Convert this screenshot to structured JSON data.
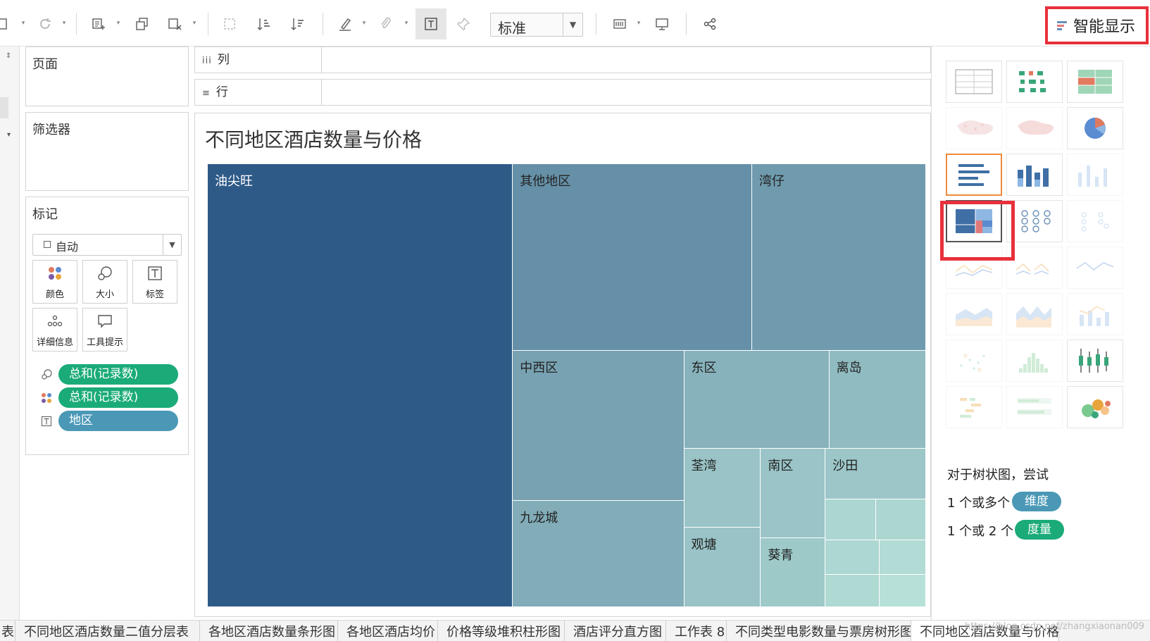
{
  "toolbar": {
    "fit_select": {
      "value": "标准"
    },
    "show_me_button": {
      "label": "智能显示"
    }
  },
  "panels": {
    "pages": {
      "title": "页面"
    },
    "filters": {
      "title": "筛选器"
    },
    "marks": {
      "title": "标记",
      "mark_type": "自动",
      "cards": [
        {
          "label": "颜色",
          "icon": "color-dots-icon"
        },
        {
          "label": "大小",
          "icon": "size-circles-icon"
        },
        {
          "label": "标签",
          "icon": "label-text-icon"
        },
        {
          "label": "详细信息",
          "icon": "detail-dots-icon"
        },
        {
          "label": "工具提示",
          "icon": "tooltip-bubble-icon"
        }
      ],
      "pills": [
        {
          "encoding": "size",
          "label": "总和(记录数)",
          "color": "#1aab78"
        },
        {
          "encoding": "color",
          "label": "总和(记录数)",
          "color": "#1aab78"
        },
        {
          "encoding": "label",
          "label": "地区",
          "color": "#4a98b6"
        }
      ]
    }
  },
  "shelves": {
    "columns": {
      "label": "列"
    },
    "rows": {
      "label": "行"
    }
  },
  "view": {
    "title": "不同地区酒店数量与价格"
  },
  "chart_data": {
    "type": "treemap",
    "title": "不同地区酒店数量与价格",
    "size_measure": "总和(记录数)",
    "color_measure": "总和(记录数)",
    "label_dimension": "地区",
    "color_scale": [
      "#b7e1d8",
      "#2e5a87"
    ],
    "items": [
      {
        "label": "油尖旺",
        "value": 100
      },
      {
        "label": "其他地区",
        "value": 33
      },
      {
        "label": "湾仔",
        "value": 24
      },
      {
        "label": "中西区",
        "value": 19
      },
      {
        "label": "九龙城",
        "value": 13.5
      },
      {
        "label": "东区",
        "value": 10.5
      },
      {
        "label": "离岛",
        "value": 7
      },
      {
        "label": "荃湾",
        "value": 4.5
      },
      {
        "label": "观塘",
        "value": 4.5
      },
      {
        "label": "南区",
        "value": 4.3
      },
      {
        "label": "葵青",
        "value": 3.3
      },
      {
        "label": "沙田",
        "value": 3.8
      },
      {
        "label": "",
        "value": 1.5
      },
      {
        "label": "",
        "value": 1.5
      },
      {
        "label": "",
        "value": 1.4
      },
      {
        "label": "",
        "value": 1.3
      },
      {
        "label": "",
        "value": 1.2
      },
      {
        "label": "",
        "value": 1.1
      }
    ]
  },
  "show_me": {
    "chart_types": [
      "text-table",
      "heat-map",
      "highlight-table",
      "symbol-map",
      "filled-map",
      "pie-chart",
      "horizontal-bars",
      "stacked-bars",
      "side-by-side-bars",
      "treemap",
      "circle-view",
      "side-by-side-circles",
      "lines-continuous",
      "lines-discrete",
      "dual-lines",
      "area-continuous",
      "area-discrete",
      "dual-combination",
      "scatter-plot",
      "histogram",
      "box-and-whisker",
      "gantt-chart",
      "bullet-graph",
      "packed-bubbles"
    ],
    "hint": "对于树状图，尝试",
    "requirements": [
      {
        "text": "1 个或多个",
        "badge": "维度",
        "badge_color": "#4a98b6"
      },
      {
        "text": "1 个或 2 个",
        "badge": "度量",
        "badge_color": "#1aab78"
      }
    ]
  },
  "sheet_tabs": [
    "表",
    "不同地区酒店数量二值分层表",
    "各地区酒店数量条形图",
    "各地区酒店均价",
    "价格等级堆积柱形图",
    "酒店评分直方图",
    "工作表 8",
    "不同类型电影数量与票房树形图",
    "不同地区酒店数量与价格"
  ],
  "watermark": "https://blog.csdn.net/zhangxiaonan009"
}
